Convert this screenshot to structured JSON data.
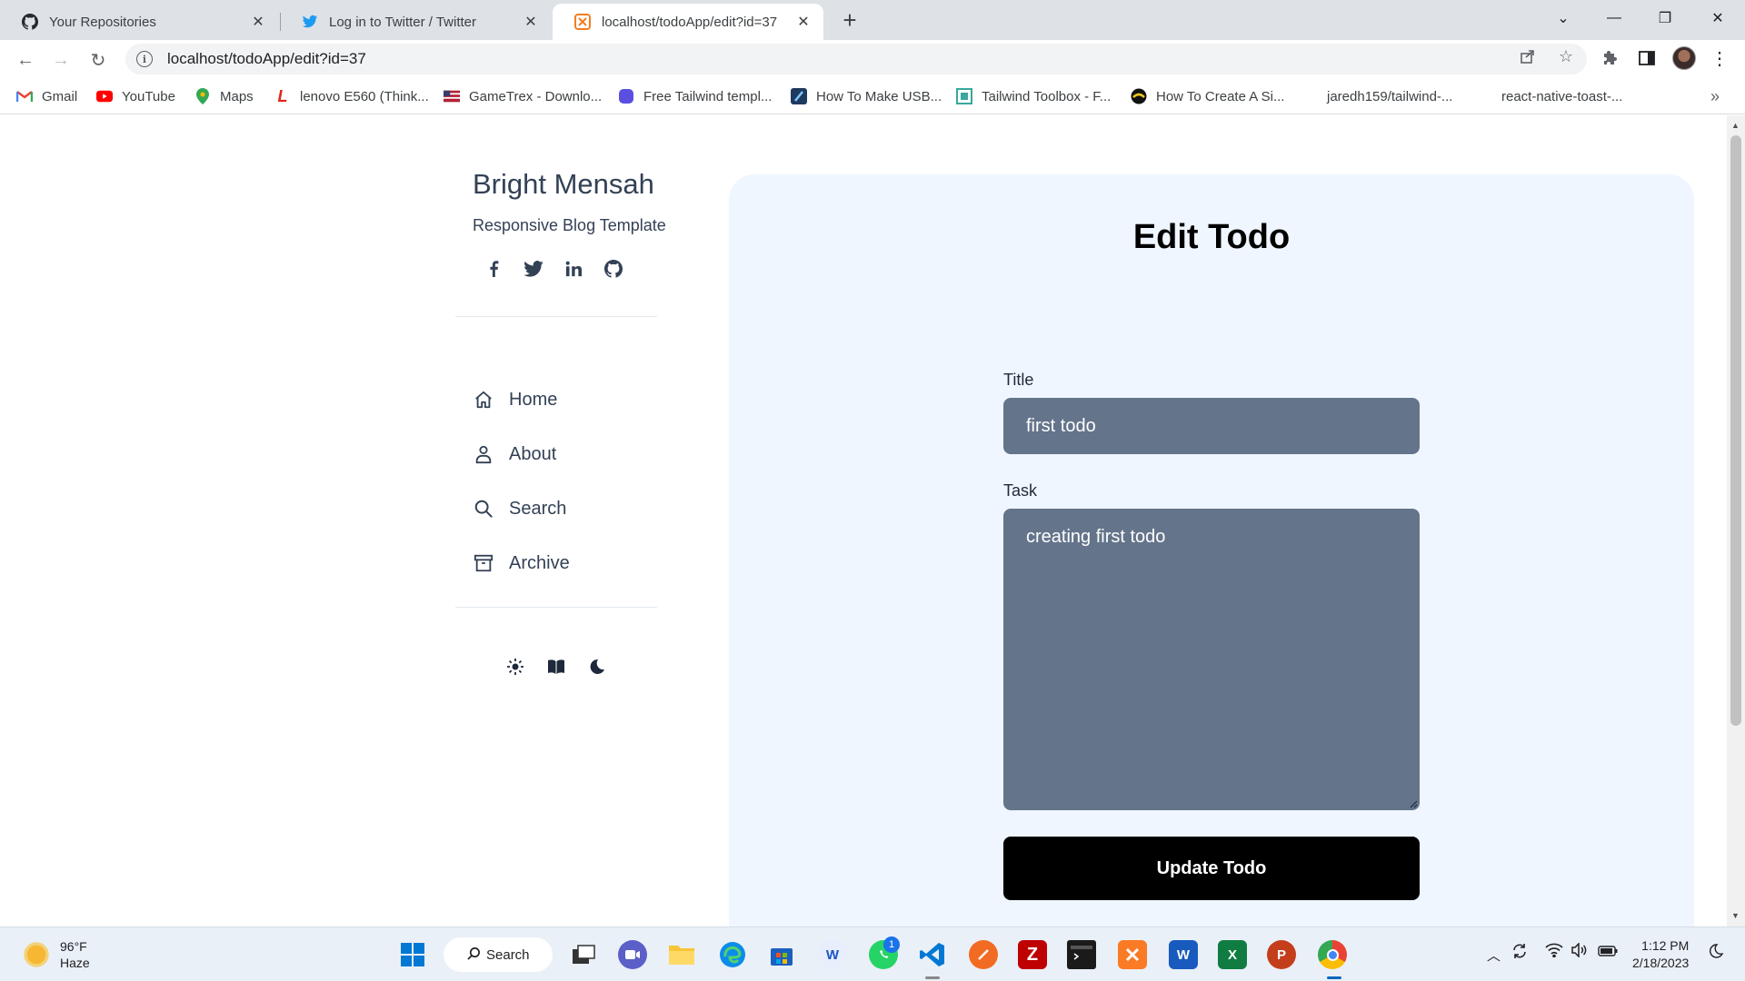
{
  "browser": {
    "tabs": [
      {
        "title": "Your Repositories",
        "icon": "github-icon"
      },
      {
        "title": "Log in to Twitter / Twitter",
        "icon": "twitter-icon"
      },
      {
        "title": "localhost/todoApp/edit?id=37",
        "icon": "xampp-icon",
        "active": true
      }
    ],
    "url": "localhost/todoApp/edit?id=37",
    "bookmarks": [
      {
        "label": "Gmail",
        "icon": "gmail-icon"
      },
      {
        "label": "YouTube",
        "icon": "youtube-icon"
      },
      {
        "label": "Maps",
        "icon": "maps-icon"
      },
      {
        "label": "lenovo E560 (Think...",
        "icon": "lenovo-icon"
      },
      {
        "label": "GameTrex - Downlo...",
        "icon": "gametrex-icon"
      },
      {
        "label": "Free Tailwind templ...",
        "icon": "tailwind-icon"
      },
      {
        "label": "How To Make USB...",
        "icon": "usb-icon"
      },
      {
        "label": "Tailwind Toolbox - F...",
        "icon": "toolbox-icon"
      },
      {
        "label": "How To Create A Si...",
        "icon": "site-icon"
      },
      {
        "label": "jaredh159/tailwind-...",
        "icon": "none"
      },
      {
        "label": "react-native-toast-...",
        "icon": "none"
      }
    ]
  },
  "sidebar": {
    "brand": "Bright Mensah",
    "tagline": "Responsive Blog Template",
    "social": [
      "facebook-icon",
      "twitter-icon",
      "linkedin-icon",
      "github-icon"
    ],
    "nav": [
      {
        "label": "Home",
        "icon": "home-icon"
      },
      {
        "label": "About",
        "icon": "user-icon"
      },
      {
        "label": "Search",
        "icon": "search-icon"
      },
      {
        "label": "Archive",
        "icon": "archive-icon"
      }
    ],
    "themes": [
      "sun-icon",
      "book-icon",
      "moon-icon"
    ]
  },
  "main": {
    "heading": "Edit Todo",
    "title_label": "Title",
    "title_value": "first todo",
    "task_label": "Task",
    "task_value": "creating first todo",
    "submit_label": "Update Todo"
  },
  "taskbar": {
    "weather_temp": "96°F",
    "weather_desc": "Haze",
    "search_label": "Search",
    "whatsapp_badge": "1",
    "time": "1:12 PM",
    "date": "2/18/2023"
  },
  "colors": {
    "card_bg": "#eff6ff",
    "input_bg": "#64748b",
    "button_bg": "#000000",
    "sidebar_text": "#334155"
  }
}
